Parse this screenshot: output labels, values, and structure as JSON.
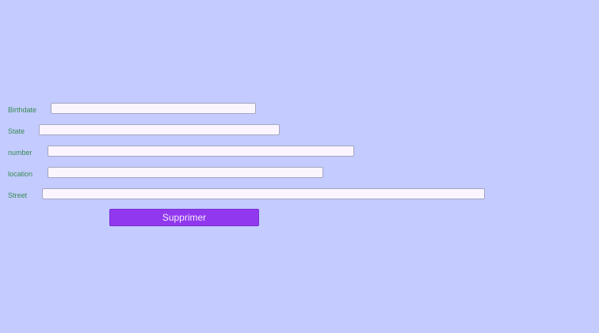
{
  "form": {
    "fields": [
      {
        "label": "Birthdate",
        "value": "",
        "placeholder": ""
      },
      {
        "label": "State",
        "value": "",
        "placeholder": ""
      },
      {
        "label": "number",
        "value": "",
        "placeholder": ""
      },
      {
        "label": "location",
        "value": "",
        "placeholder": ""
      },
      {
        "label": "Street",
        "value": "",
        "placeholder": ""
      }
    ],
    "submit_label": "Supprimer"
  },
  "colors": {
    "background": "#c3cbff",
    "label_text": "#3a8a55",
    "field_background": "#fbf5ff",
    "button_background": "#9138ee",
    "button_text": "#f4eaff"
  }
}
